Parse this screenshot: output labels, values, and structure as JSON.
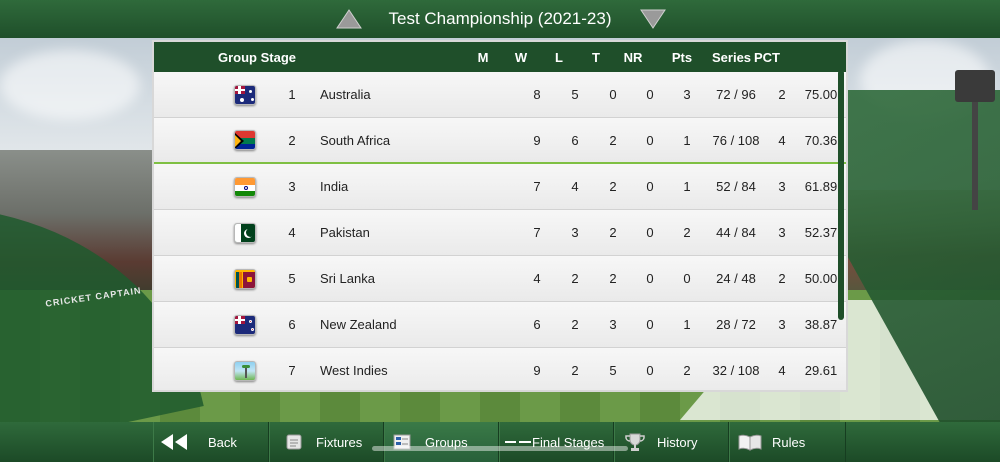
{
  "header": {
    "title": "Test Championship (2021-23)"
  },
  "table": {
    "columns": {
      "group": "Group Stage",
      "m": "M",
      "w": "W",
      "l": "L",
      "t": "T",
      "nr": "NR",
      "pts": "Pts",
      "series": "Series",
      "pct": "PCT"
    },
    "rows": [
      {
        "rank": "1",
        "team": "Australia",
        "flag": "australia-flag-icon",
        "m": "8",
        "w": "5",
        "l": "0",
        "t": "0",
        "nr": "3",
        "pts": "72 / 96",
        "series": "2",
        "pct": "75.00"
      },
      {
        "rank": "2",
        "team": "South Africa",
        "flag": "south-africa-flag-icon",
        "m": "9",
        "w": "6",
        "l": "2",
        "t": "0",
        "nr": "1",
        "pts": "76 / 108",
        "series": "4",
        "pct": "70.36"
      },
      {
        "rank": "3",
        "team": "India",
        "flag": "india-flag-icon",
        "m": "7",
        "w": "4",
        "l": "2",
        "t": "0",
        "nr": "1",
        "pts": "52 / 84",
        "series": "3",
        "pct": "61.89"
      },
      {
        "rank": "4",
        "team": "Pakistan",
        "flag": "pakistan-flag-icon",
        "m": "7",
        "w": "3",
        "l": "2",
        "t": "0",
        "nr": "2",
        "pts": "44 / 84",
        "series": "3",
        "pct": "52.37"
      },
      {
        "rank": "5",
        "team": "Sri Lanka",
        "flag": "sri-lanka-flag-icon",
        "m": "4",
        "w": "2",
        "l": "2",
        "t": "0",
        "nr": "0",
        "pts": "24 / 48",
        "series": "2",
        "pct": "50.00"
      },
      {
        "rank": "6",
        "team": "New Zealand",
        "flag": "new-zealand-flag-icon",
        "m": "6",
        "w": "2",
        "l": "3",
        "t": "0",
        "nr": "1",
        "pts": "28 / 72",
        "series": "3",
        "pct": "38.87"
      },
      {
        "rank": "7",
        "team": "West Indies",
        "flag": "west-indies-flag-icon",
        "m": "9",
        "w": "2",
        "l": "5",
        "t": "0",
        "nr": "2",
        "pts": "32 / 108",
        "series": "4",
        "pct": "29.61"
      }
    ]
  },
  "background": {
    "banner": "CRICKET CAPTAIN"
  },
  "bottom_nav": {
    "back": "Back",
    "fixtures": "Fixtures",
    "groups": "Groups",
    "final_stages": "Final Stages",
    "history": "History",
    "rules": "Rules"
  },
  "colors": {
    "bar_green": "#1f4f2a",
    "highlight_line": "#7fc043"
  }
}
